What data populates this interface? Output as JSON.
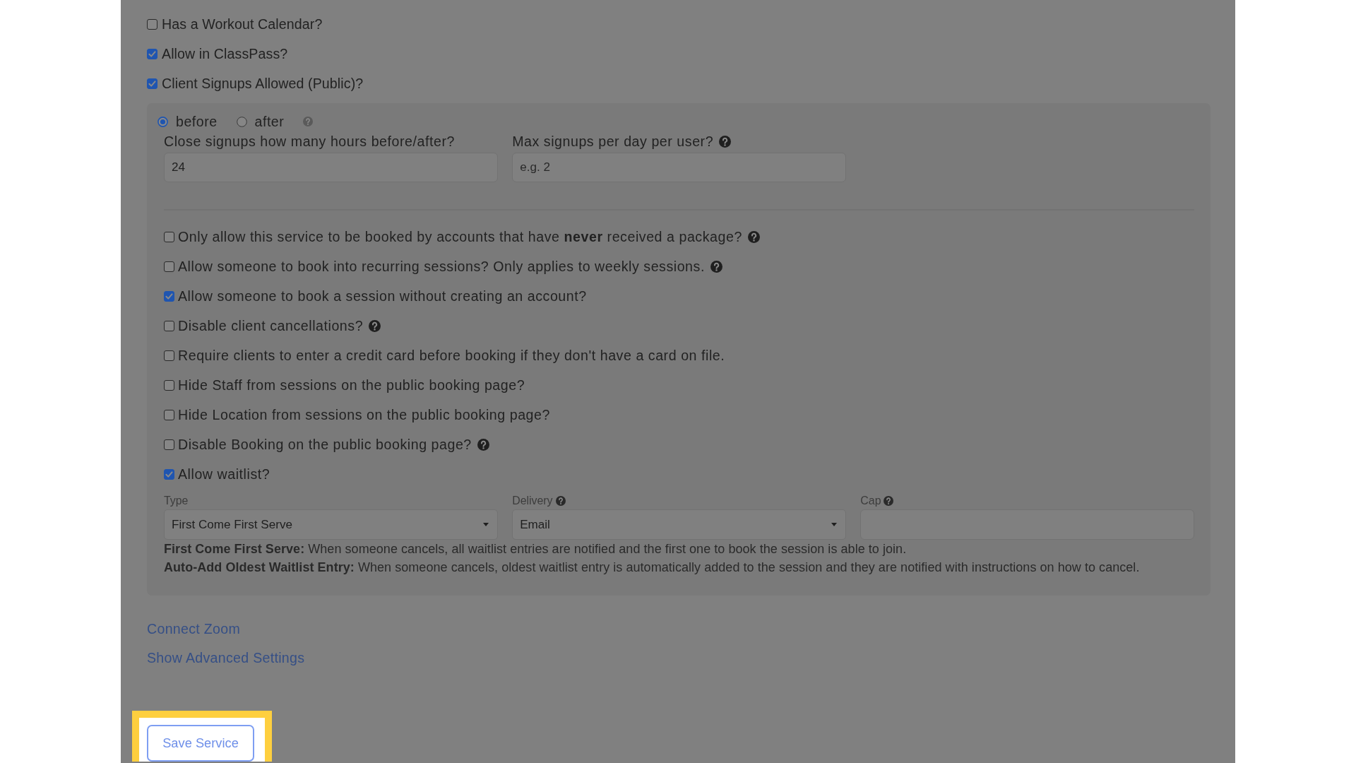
{
  "checkboxes": [
    {
      "label": "Has a Workout Calendar?",
      "checked": false
    },
    {
      "label": "Allow in ClassPass?",
      "checked": true
    },
    {
      "label": "Client Signups Allowed (Public)?",
      "checked": true
    }
  ],
  "signup_panel": {
    "timing": {
      "options": [
        {
          "label": "before",
          "selected": true
        },
        {
          "label": "after",
          "selected": false
        }
      ],
      "help": true
    },
    "fields": [
      {
        "label": "Close signups how many hours before/after?",
        "value": "24",
        "help": false
      },
      {
        "label": "Max signups per day per user?",
        "placeholder": "e.g. 2",
        "help": true
      }
    ],
    "options": [
      {
        "label": "Only allow this service to be booked by accounts that have **never** received a package?",
        "checked": false,
        "help": true
      },
      {
        "label": "Allow someone to book into recurring sessions? Only applies to weekly sessions.",
        "checked": false,
        "help": true
      },
      {
        "label": "Allow someone to book a session without creating an account?",
        "checked": true,
        "help": false
      },
      {
        "label": "Disable client cancellations?",
        "checked": false,
        "help": true
      },
      {
        "label": "Require clients to enter a credit card before booking if they don't have a card on file.",
        "checked": false,
        "help": false
      },
      {
        "label": "Hide Staff from sessions on the public booking page?",
        "checked": false,
        "help": false
      },
      {
        "label": "Hide Location from sessions on the public booking page?",
        "checked": false,
        "help": false
      },
      {
        "label": "Disable Booking on the public booking page?",
        "checked": false,
        "help": true
      },
      {
        "label": "Allow waitlist?",
        "checked": true,
        "help": false
      }
    ],
    "waitlist": {
      "fields": [
        {
          "kind": "select",
          "label": "Type",
          "value": "First Come First Serve",
          "help": false
        },
        {
          "kind": "select",
          "label": "Delivery",
          "value": "Email",
          "help": true
        },
        {
          "kind": "input",
          "label": "Cap",
          "help": true
        }
      ],
      "notes": [
        "**First Come First Serve:** When someone cancels, all waitlist entries are notified and the first one to book the session is able to join.",
        "**Auto-Add Oldest Waitlist Entry:** When someone cancels, oldest waitlist entry is automatically added to the session and they are notified with instructions on how to cancel."
      ]
    }
  },
  "links": [
    "Connect Zoom",
    "Show Advanced Settings"
  ],
  "save_button": {
    "label": "Save Service",
    "highlighted": true
  }
}
